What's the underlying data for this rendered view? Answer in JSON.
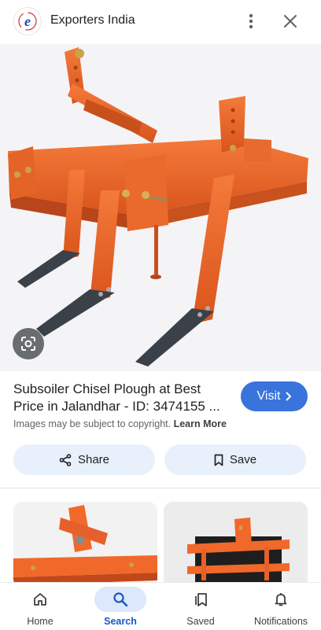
{
  "header": {
    "site_name": "Exporters India",
    "logo_letter": "e",
    "more_icon": "more-vert-icon",
    "close_icon": "close-icon"
  },
  "result": {
    "title_line1": "Subsoiler Chisel Plough at Best",
    "title_line2": "Price in Jalandhar - ID: 3474155 ...",
    "visit_label": "Visit",
    "copyright_text": "Images may be subject to copyright.",
    "learn_more": "Learn More"
  },
  "actions": {
    "share_label": "Share",
    "save_label": "Save"
  },
  "colors": {
    "accent": "#3874db",
    "implement_orange": "#f0692a",
    "chip_bg": "#e8f0fb",
    "nav_active_bg": "#dce8fb"
  },
  "bottom_nav": {
    "items": [
      {
        "label": "Home",
        "icon": "home-icon"
      },
      {
        "label": "Search",
        "icon": "search-icon",
        "active": true
      },
      {
        "label": "Saved",
        "icon": "bookmarks-icon"
      },
      {
        "label": "Notifications",
        "icon": "bell-icon"
      }
    ]
  }
}
